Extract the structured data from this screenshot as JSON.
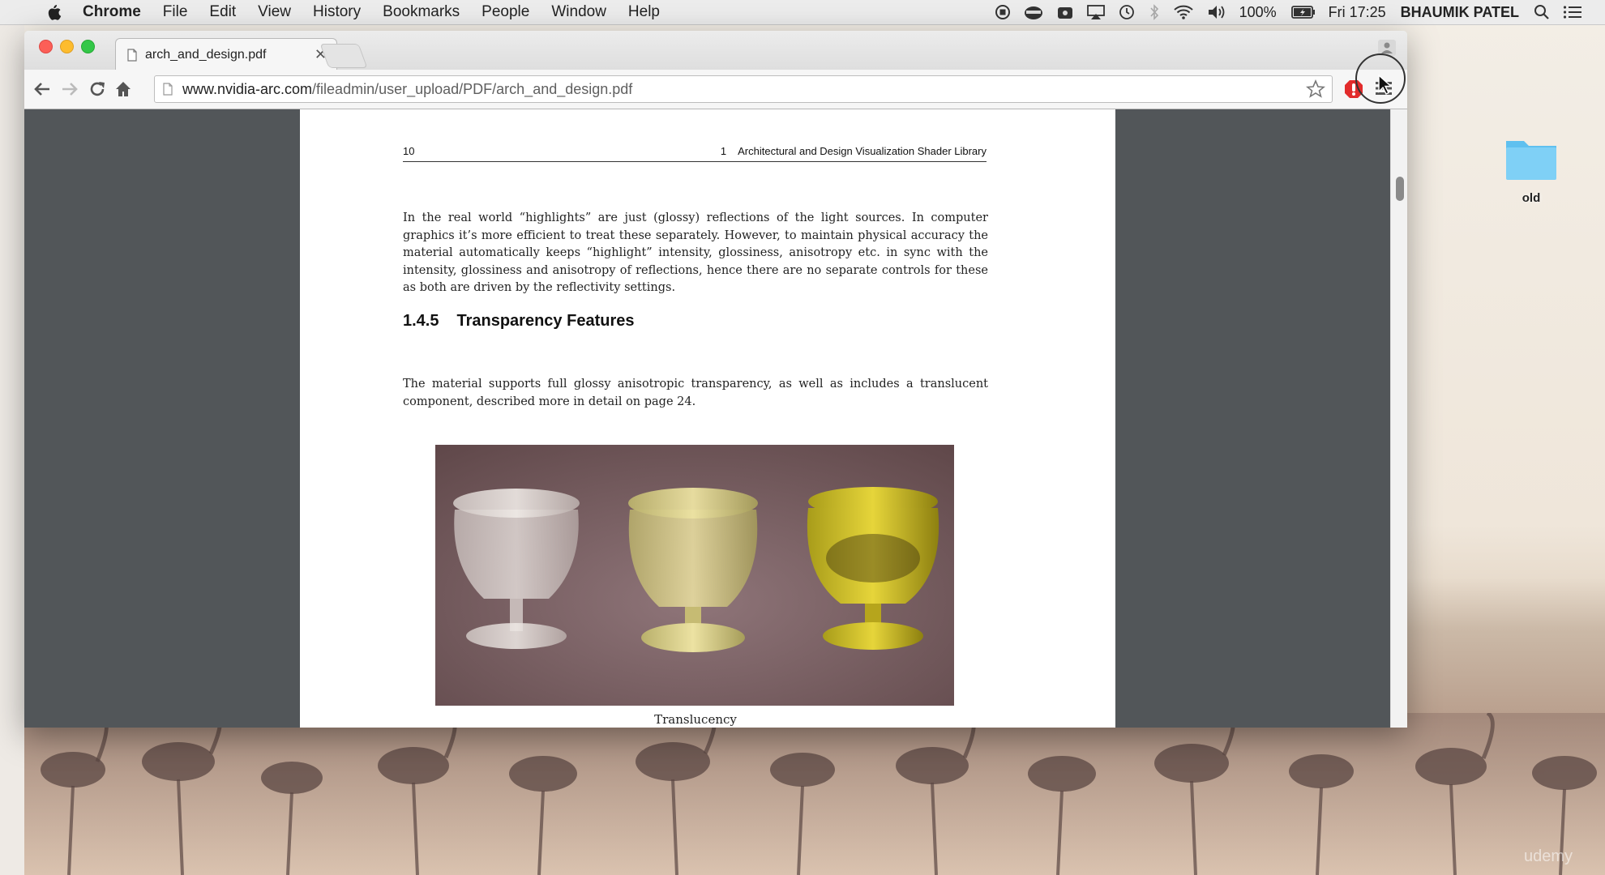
{
  "menubar": {
    "app_name": "Chrome",
    "items": [
      "File",
      "Edit",
      "View",
      "History",
      "Bookmarks",
      "People",
      "Window",
      "Help"
    ],
    "battery": "100%",
    "clock": "Fri 17:25",
    "user": "BHAUMIK PATEL"
  },
  "browser": {
    "tab_title": "arch_and_design.pdf",
    "url_host": "www.nvidia-arc.com",
    "url_path": "/fileadmin/user_upload/PDF/arch_and_design.pdf"
  },
  "pdf": {
    "page_number": "10",
    "chapter_number": "1",
    "chapter_title": "Architectural and Design Visualization Shader Library",
    "paragraph_1": "In the real world “highlights” are just (glossy) reflections of the light sources. In computer graphics it’s more efficient to treat these separately. However, to maintain physical accuracy the material automatically keeps “highlight” intensity, glossiness, anisotropy etc. in sync with the intensity, glossiness and anisotropy of reflections, hence there are no separate controls for these as both are driven by the reflectivity settings.",
    "section_number": "1.4.5",
    "section_title": "Transparency Features",
    "paragraph_2": "The material supports full glossy anisotropic transparency, as well as includes a translucent component, described more in detail on page 24.",
    "figure_caption": "Translucency"
  },
  "desktop": {
    "folder_label": "old",
    "watermark": "udemy"
  }
}
